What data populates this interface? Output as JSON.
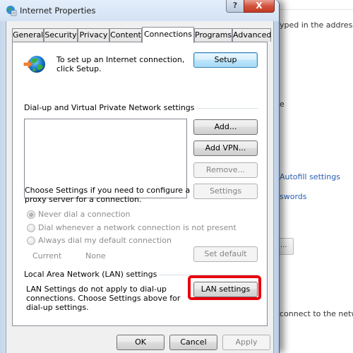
{
  "background_page": {
    "text_address_bar": "yped in the address ba",
    "text_e": "e",
    "link_autofill": "Autofill settings",
    "link_passwords": "swords",
    "button_ellipsis": "...",
    "text_connect": "connect to the netwo"
  },
  "window": {
    "title": "Internet Properties",
    "help_label": "?",
    "close_label": "X"
  },
  "tabs": [
    {
      "label": "General",
      "active": false
    },
    {
      "label": "Security",
      "active": false
    },
    {
      "label": "Privacy",
      "active": false
    },
    {
      "label": "Content",
      "active": false
    },
    {
      "label": "Connections",
      "active": true
    },
    {
      "label": "Programs",
      "active": false
    },
    {
      "label": "Advanced",
      "active": false
    }
  ],
  "connections": {
    "setup_text": "To set up an Internet connection, click Setup.",
    "setup_button": "Setup",
    "dialup_group_label": "Dial-up and Virtual Private Network settings",
    "vpn_list_items": [],
    "add_button": "Add...",
    "add_vpn_button": "Add VPN...",
    "remove_button": "Remove...",
    "proxy_text": "Choose Settings if you need to configure a proxy server for a connection.",
    "settings_button": "Settings",
    "radio_options": [
      {
        "label": "Never dial a connection",
        "checked": true,
        "disabled": true
      },
      {
        "label": "Dial whenever a network connection is not present",
        "checked": false,
        "disabled": true
      },
      {
        "label": "Always dial my default connection",
        "checked": false,
        "disabled": true
      }
    ],
    "current_label": "Current",
    "current_value": "None",
    "set_default_button": "Set default",
    "lan_group_label": "Local Area Network (LAN) settings",
    "lan_text": "LAN Settings do not apply to dial-up connections. Choose Settings above for dial-up settings.",
    "lan_settings_button": "LAN settings",
    "highlight_color": "#e8000c"
  },
  "footer": {
    "ok_button": "OK",
    "cancel_button": "Cancel",
    "apply_button": "Apply"
  }
}
